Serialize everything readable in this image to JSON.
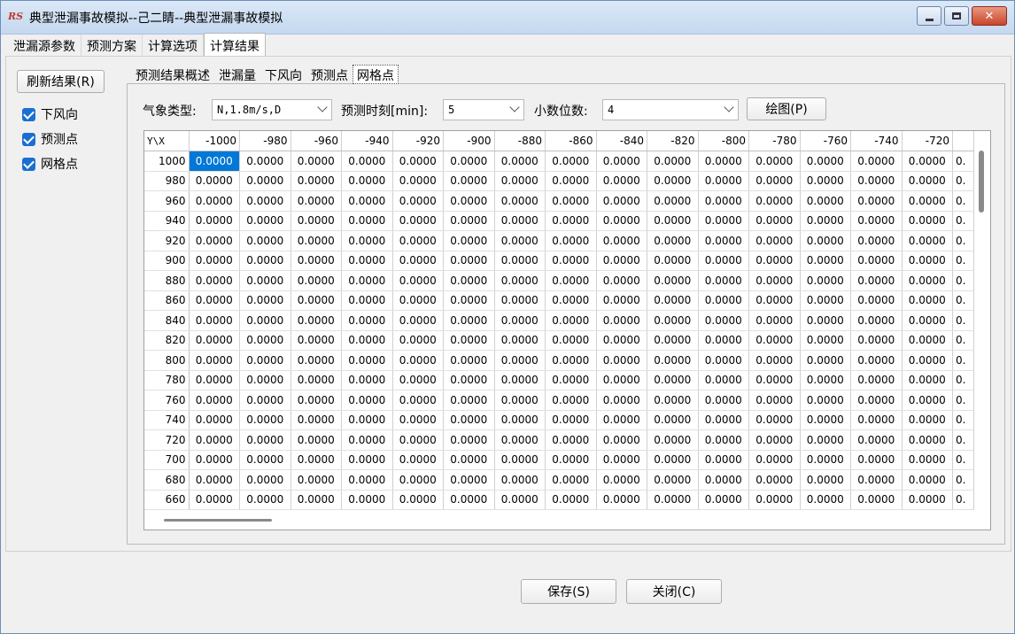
{
  "window": {
    "icon_text": "RS",
    "title": "典型泄漏事故模拟--己二睛--典型泄漏事故模拟"
  },
  "top_tabs": [
    "泄漏源参数",
    "预测方案",
    "计算选项",
    "计算结果"
  ],
  "top_tab_active": 3,
  "left_panel": {
    "refresh_label": "刷新结果(R)",
    "checks": [
      {
        "label": "下风向",
        "checked": true
      },
      {
        "label": "预测点",
        "checked": true
      },
      {
        "label": "网格点",
        "checked": true
      }
    ]
  },
  "sub_tabs": [
    "预测结果概述",
    "泄漏量",
    "下风向",
    "预测点",
    "网格点"
  ],
  "sub_tab_active": 4,
  "options": {
    "weather_label": "气象类型:",
    "weather_value": "N,1.8m/s,D",
    "time_label": "预测时刻[min]:",
    "time_value": "5",
    "decimals_label": "小数位数:",
    "decimals_value": "4",
    "draw_label": "绘图(P)"
  },
  "grid": {
    "corner": "Y\\X",
    "columns": [
      "-1000",
      "-980",
      "-960",
      "-940",
      "-920",
      "-900",
      "-880",
      "-860",
      "-840",
      "-820",
      "-800",
      "-780",
      "-760",
      "-740",
      "-720",
      ""
    ],
    "rows": [
      "1000",
      "980",
      "960",
      "940",
      "920",
      "900",
      "880",
      "860",
      "840",
      "820",
      "800",
      "780",
      "760",
      "740",
      "720",
      "700",
      "680",
      "660"
    ],
    "cell_value": "0.0000",
    "last_col_value": "0.",
    "selected_cell": [
      0,
      0
    ]
  },
  "footer": {
    "save_label": "保存(S)",
    "close_label": "关闭(C)"
  },
  "colors": {
    "accent": "#0078d7",
    "checkbox": "#1a6fd0"
  }
}
